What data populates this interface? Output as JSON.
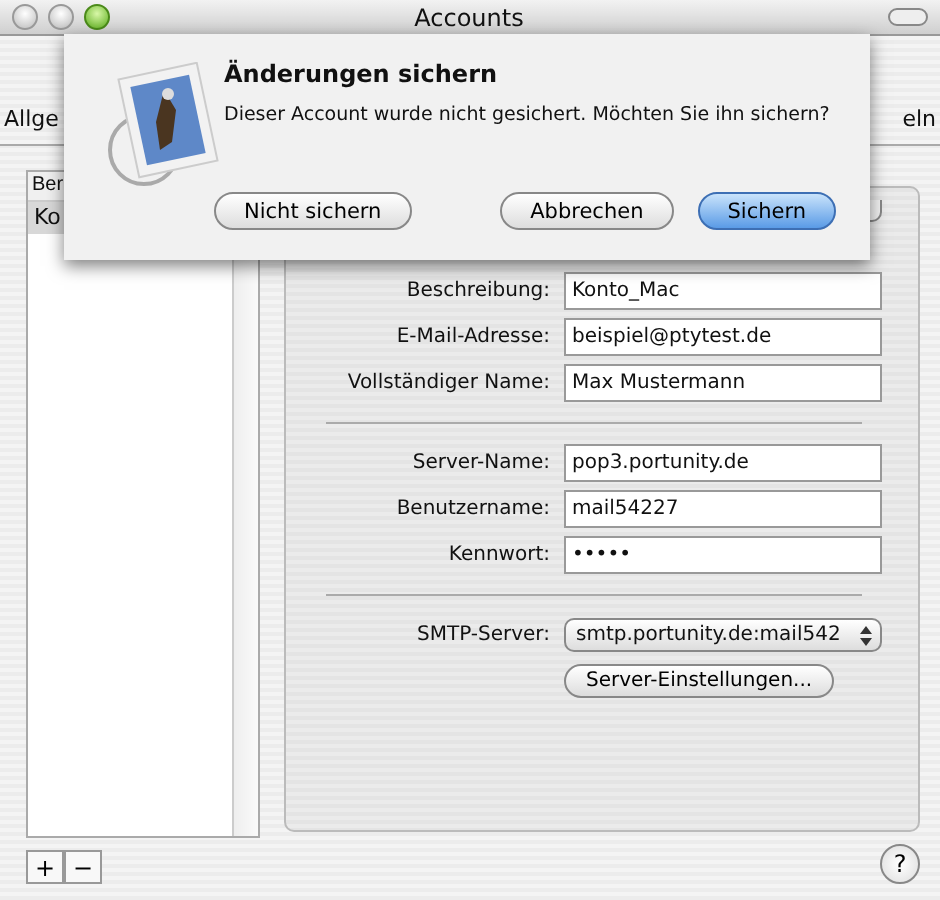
{
  "window": {
    "title": "Accounts"
  },
  "toolbar": {
    "left_item": "Allge",
    "right_item": "eln"
  },
  "account_list": {
    "header": "Ber",
    "items": [
      {
        "label": "Ko",
        "selected": true
      }
    ]
  },
  "form": {
    "groups": [
      [
        {
          "label": "Beschreibung:",
          "value": "Konto_Mac"
        },
        {
          "label": "E-Mail-Adresse:",
          "value": "beispiel@ptytest.de"
        },
        {
          "label": "Vollständiger Name:",
          "value": "Max Mustermann"
        }
      ],
      [
        {
          "label": "Server-Name:",
          "value": "pop3.portunity.de"
        },
        {
          "label": "Benutzername:",
          "value": "mail54227"
        },
        {
          "label": "Kennwort:",
          "value": "•••••"
        }
      ]
    ],
    "smtp": {
      "label": "SMTP-Server:",
      "value": "smtp.portunity.de:mail542"
    },
    "settings_button": "Server-Einstellungen..."
  },
  "list_buttons": [
    "+",
    "−"
  ],
  "help": "?",
  "sheet": {
    "title": "Änderungen sichern",
    "message": "Dieser Account wurde nicht gesichert. Möchten Sie ihn sichern?",
    "buttons": [
      {
        "label": "Nicht sichern",
        "default": false
      },
      {
        "label": "Abbrechen",
        "default": false
      },
      {
        "label": "Sichern",
        "default": true
      }
    ]
  }
}
